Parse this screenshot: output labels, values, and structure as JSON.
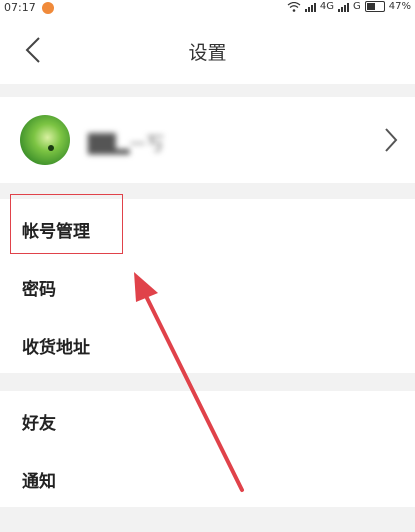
{
  "status_bar": {
    "time": "07:17",
    "network_label": "4G",
    "network_label_2": "G",
    "battery": "47%"
  },
  "header": {
    "title": "设置"
  },
  "profile": {
    "username": "██▂ᅳ丂"
  },
  "groups": [
    {
      "items": [
        {
          "label": "帐号管理"
        },
        {
          "label": "密码"
        },
        {
          "label": "收货地址"
        }
      ]
    },
    {
      "items": [
        {
          "label": "好友"
        },
        {
          "label": "通知"
        }
      ]
    }
  ],
  "colors": {
    "annotation_red": "#e0424a",
    "background": "#f2f2f2"
  },
  "icons": {
    "back": "chevron-left-icon",
    "profile_arrow": "chevron-right-icon"
  }
}
